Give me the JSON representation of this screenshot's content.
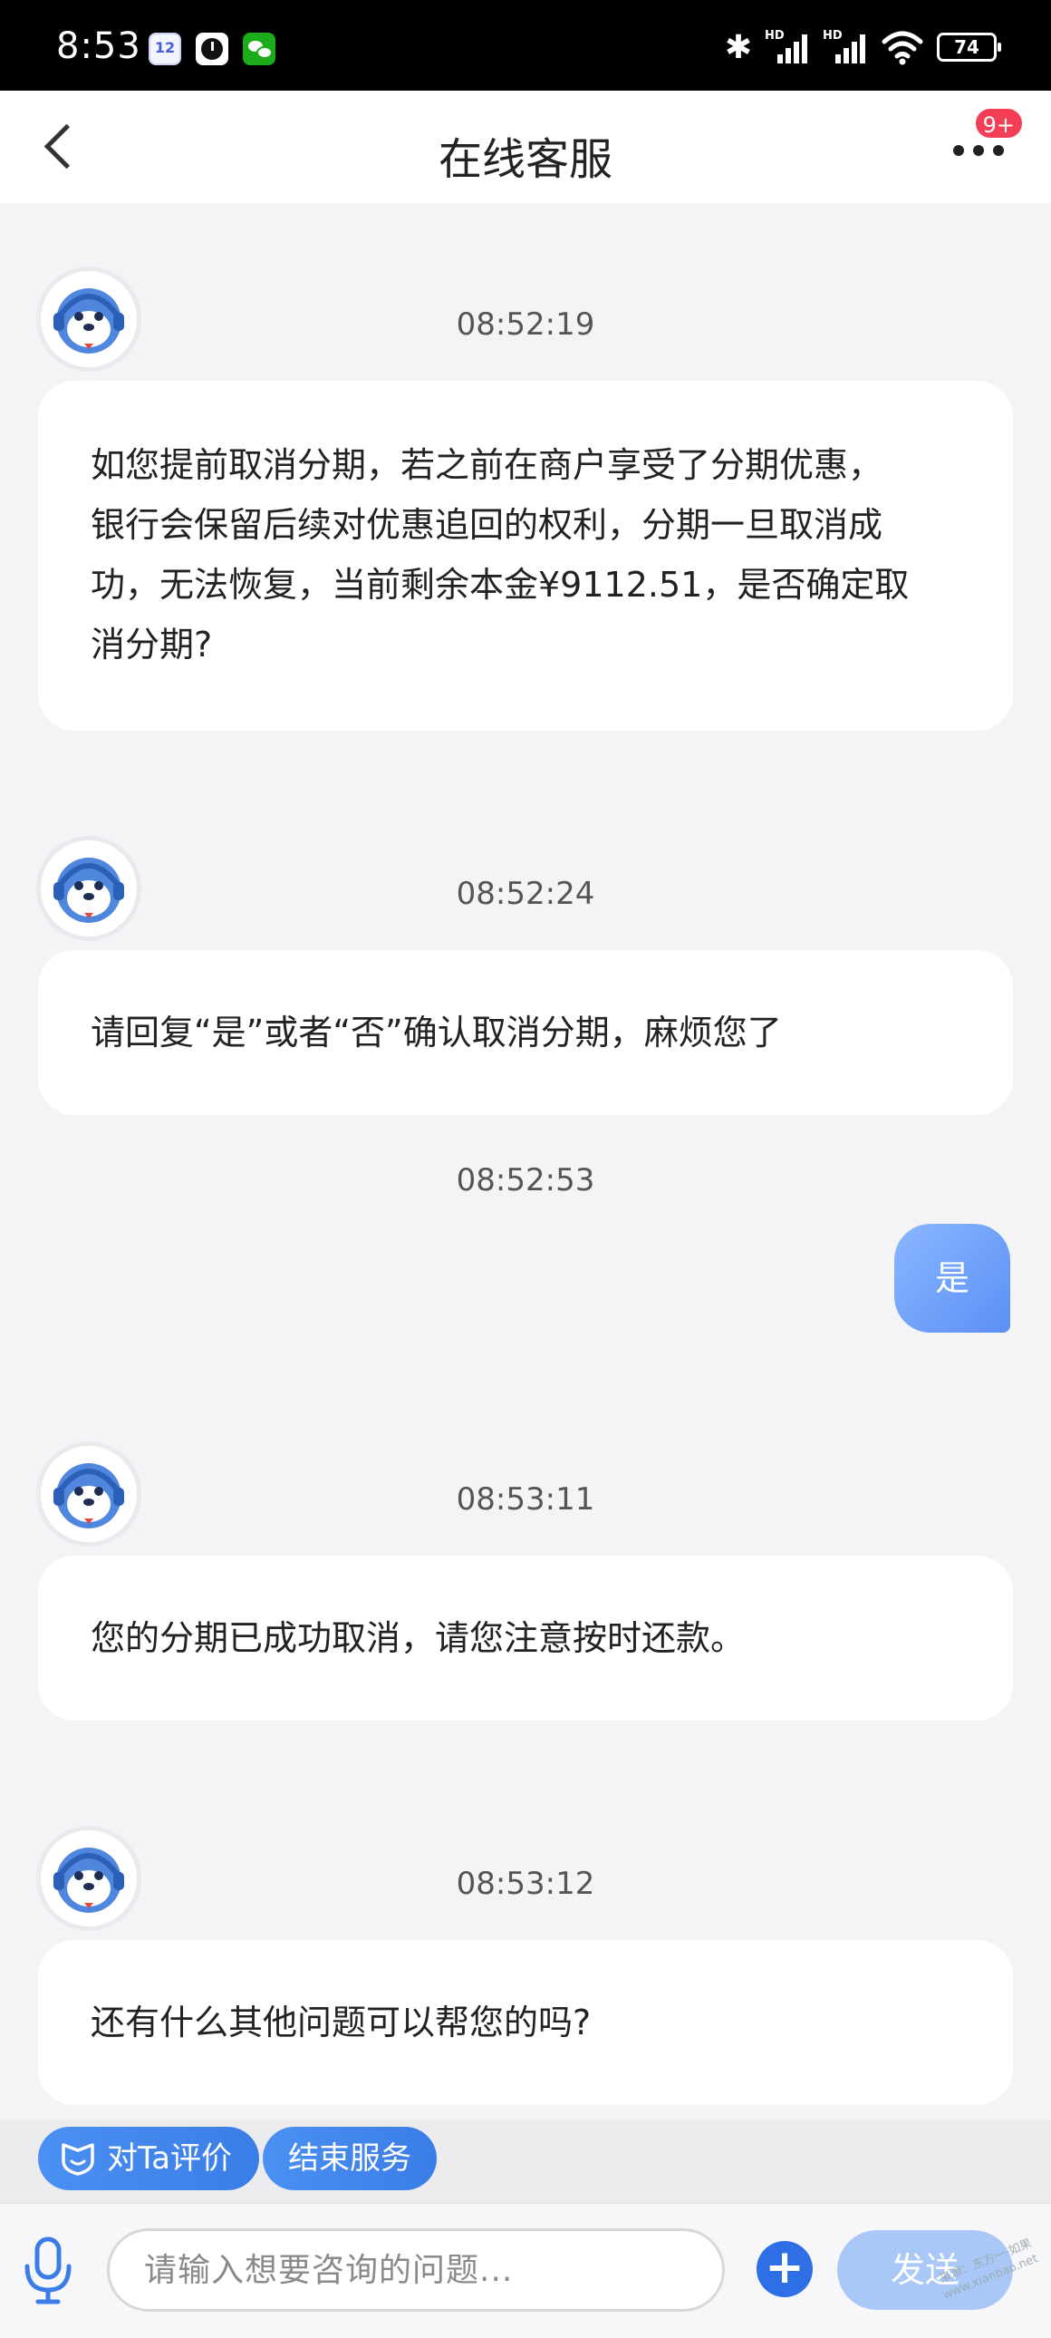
{
  "status_bar": {
    "time": "8:53",
    "calendar_day": "12",
    "signal_label_1": "HD",
    "signal_label_2": "HD",
    "battery": "74"
  },
  "header": {
    "title": "在线客服",
    "badge": "9+"
  },
  "messages": [
    {
      "time": "08:52:19",
      "lines": [
        "如您提前取消分期，若之前在商户享受了分期优惠，",
        "银行会保留后续对优惠追回的权利，分期一旦取消成",
        "功，无法恢复，当前剩余本金¥9112.51，是否确定取",
        "消分期?"
      ]
    },
    {
      "time": "08:52:24",
      "lines": [
        "请回复“是”或者“否”确认取消分期，麻烦您了"
      ]
    },
    {
      "time": "08:52:53",
      "user_text": "是"
    },
    {
      "time": "08:53:11",
      "lines": [
        "您的分期已成功取消，请您注意按时还款。"
      ]
    },
    {
      "time": "08:53:12",
      "lines": [
        "还有什么其他问题可以帮您的吗?"
      ]
    }
  ],
  "quick_actions": {
    "rate": "对Ta评价",
    "end": "结束服务"
  },
  "input_bar": {
    "placeholder": "请输入想要咨询的问题...",
    "plus": "+",
    "send": "发送"
  },
  "watermark": {
    "line1": "来源：东方一·如果",
    "line2": "www.xianbao.net"
  },
  "colors": {
    "accent": "#3a7de8",
    "user_bubble": "#6f9ff8",
    "badge": "#f23f56"
  }
}
